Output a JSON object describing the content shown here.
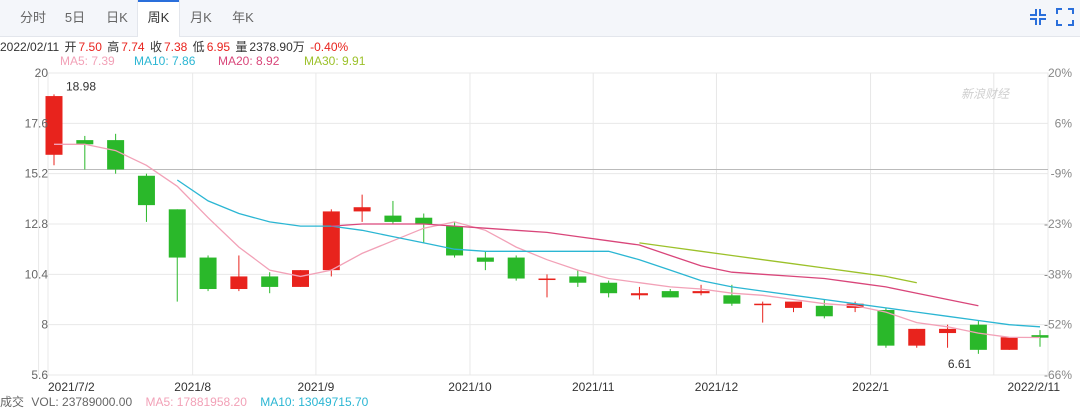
{
  "tabs": [
    {
      "label": "分时",
      "active": false
    },
    {
      "label": "5日",
      "active": false
    },
    {
      "label": "日K",
      "active": false
    },
    {
      "label": "周K",
      "active": true
    },
    {
      "label": "月K",
      "active": false
    },
    {
      "label": "年K",
      "active": false
    }
  ],
  "toolbar": {
    "shrink_icon": "collapse-icon",
    "expand_icon": "expand-icon"
  },
  "info": {
    "date": "2022/02/11",
    "open_label": "开",
    "open": "7.50",
    "high_label": "高",
    "high": "7.74",
    "close_label": "收",
    "close": "7.38",
    "low_label": "低",
    "low": "6.95",
    "vol_label": "量",
    "vol": "2378.90万",
    "change": "-0.40%"
  },
  "ma": [
    {
      "label": "MA5: 7.39",
      "color": "#f2a1b7"
    },
    {
      "label": "MA10: 7.86",
      "color": "#2bb6d3"
    },
    {
      "label": "MA20: 8.92",
      "color": "#d9467a"
    },
    {
      "label": "MA30: 9.91",
      "color": "#9cc12a"
    }
  ],
  "volume_legend": {
    "title": "成交",
    "vol": "VOL: 23789000.00",
    "ma5": "MA5: 17881958.20",
    "ma10": "MA10: 13049715.70",
    "ma5_color": "#f2a1b7",
    "ma10_color": "#2bb6d3"
  },
  "colors": {
    "up": "#e8231d",
    "down": "#2ab82a",
    "grid": "#e8e8e8"
  },
  "watermark": "新浪财经",
  "chart_data": {
    "type": "candlestick",
    "y_ticks": [
      "20",
      "17.6",
      "15.2",
      "12.8",
      "10.4",
      "8",
      "5.6"
    ],
    "ylim": [
      5.6,
      20
    ],
    "right_ticks": [
      "20%",
      "6%",
      "-9%",
      "-23%",
      "-38%",
      "-52%",
      "-66%"
    ],
    "x_labels": [
      {
        "label": "2021/7/2",
        "index": 0
      },
      {
        "label": "2021/8",
        "index": 5
      },
      {
        "label": "2021/9",
        "index": 9
      },
      {
        "label": "2021/10",
        "index": 14
      },
      {
        "label": "2021/11",
        "index": 18
      },
      {
        "label": "2021/12",
        "index": 22
      },
      {
        "label": "2022/1",
        "index": 27
      },
      {
        "label": "2022/2/11",
        "index": 31
      }
    ],
    "reference_price": 15.4,
    "annotations": [
      {
        "label": "18.98",
        "index": 0,
        "value": 18.98
      },
      {
        "label": "6.61",
        "index": 29,
        "value": 6.61
      }
    ],
    "candles": [
      {
        "o": 16.1,
        "h": 18.98,
        "l": 15.6,
        "c": 18.9
      },
      {
        "o": 16.8,
        "h": 17.0,
        "l": 15.4,
        "c": 16.6
      },
      {
        "o": 16.8,
        "h": 17.1,
        "l": 15.2,
        "c": 15.4
      },
      {
        "o": 15.1,
        "h": 15.2,
        "l": 12.9,
        "c": 13.7
      },
      {
        "o": 13.5,
        "h": 13.5,
        "l": 9.1,
        "c": 11.2
      },
      {
        "o": 11.2,
        "h": 11.3,
        "l": 9.6,
        "c": 9.7
      },
      {
        "o": 9.7,
        "h": 11.3,
        "l": 9.6,
        "c": 10.3
      },
      {
        "o": 10.3,
        "h": 10.5,
        "l": 9.5,
        "c": 9.8
      },
      {
        "o": 9.8,
        "h": 10.6,
        "l": 9.8,
        "c": 10.6
      },
      {
        "o": 10.6,
        "h": 13.5,
        "l": 10.3,
        "c": 13.4
      },
      {
        "o": 13.4,
        "h": 14.2,
        "l": 12.9,
        "c": 13.6
      },
      {
        "o": 13.2,
        "h": 13.9,
        "l": 12.8,
        "c": 12.9
      },
      {
        "o": 13.1,
        "h": 13.3,
        "l": 11.9,
        "c": 12.8
      },
      {
        "o": 12.7,
        "h": 12.9,
        "l": 11.2,
        "c": 11.3
      },
      {
        "o": 11.2,
        "h": 11.5,
        "l": 10.6,
        "c": 11.0
      },
      {
        "o": 11.2,
        "h": 11.3,
        "l": 10.1,
        "c": 10.2
      },
      {
        "o": 10.2,
        "h": 10.4,
        "l": 9.3,
        "c": 10.2
      },
      {
        "o": 10.3,
        "h": 10.6,
        "l": 9.8,
        "c": 10.0
      },
      {
        "o": 10.0,
        "h": 10.1,
        "l": 9.3,
        "c": 9.5
      },
      {
        "o": 9.4,
        "h": 9.8,
        "l": 9.2,
        "c": 9.5
      },
      {
        "o": 9.6,
        "h": 9.7,
        "l": 9.3,
        "c": 9.3
      },
      {
        "o": 9.5,
        "h": 9.9,
        "l": 9.4,
        "c": 9.6
      },
      {
        "o": 9.4,
        "h": 9.9,
        "l": 8.9,
        "c": 9.0
      },
      {
        "o": 9.0,
        "h": 9.1,
        "l": 8.1,
        "c": 9.0
      },
      {
        "o": 8.8,
        "h": 9.0,
        "l": 8.6,
        "c": 9.1
      },
      {
        "o": 8.9,
        "h": 9.2,
        "l": 8.3,
        "c": 8.4
      },
      {
        "o": 8.8,
        "h": 9.1,
        "l": 8.6,
        "c": 9.0
      },
      {
        "o": 8.7,
        "h": 8.8,
        "l": 6.9,
        "c": 7.0
      },
      {
        "o": 7.0,
        "h": 7.8,
        "l": 6.9,
        "c": 7.8
      },
      {
        "o": 7.6,
        "h": 8.0,
        "l": 6.9,
        "c": 7.8
      },
      {
        "o": 8.0,
        "h": 8.2,
        "l": 6.61,
        "c": 6.8
      },
      {
        "o": 6.8,
        "h": 7.4,
        "l": 6.8,
        "c": 7.4
      },
      {
        "o": 7.5,
        "h": 7.74,
        "l": 6.95,
        "c": 7.38
      }
    ],
    "series": [
      {
        "name": "MA5",
        "color": "#f2a1b7",
        "start": 0,
        "values": [
          16.6,
          16.6,
          16.3,
          15.6,
          14.6,
          13.1,
          11.7,
          10.6,
          10.3,
          10.6,
          11.4,
          12.0,
          12.6,
          12.9,
          12.5,
          11.7,
          11.1,
          10.6,
          10.2,
          10.0,
          9.8,
          9.7,
          9.5,
          9.4,
          9.2,
          9.0,
          8.9,
          8.6,
          8.1,
          7.9,
          7.6,
          7.4,
          7.39
        ]
      },
      {
        "name": "MA10",
        "color": "#2bb6d3",
        "start": 4,
        "values": [
          14.9,
          13.9,
          13.3,
          12.9,
          12.7,
          12.7,
          12.5,
          12.2,
          11.9,
          11.6,
          11.5,
          11.5,
          11.5,
          11.5,
          11.5,
          11.1,
          10.6,
          10.1,
          9.8,
          9.6,
          9.4,
          9.2,
          9.0,
          8.8,
          8.6,
          8.4,
          8.2,
          8.0,
          7.9
        ]
      },
      {
        "name": "MA20",
        "color": "#d9467a",
        "start": 9,
        "values": [
          12.7,
          12.8,
          12.8,
          12.8,
          12.7,
          12.6,
          12.5,
          12.4,
          12.2,
          12.0,
          11.8,
          11.3,
          10.8,
          10.5,
          10.4,
          10.3,
          10.2,
          10.0,
          9.8,
          9.5,
          9.2,
          8.9
        ]
      },
      {
        "name": "MA30",
        "color": "#9cc12a",
        "start": 19,
        "values": [
          11.9,
          11.7,
          11.5,
          11.3,
          11.1,
          10.9,
          10.7,
          10.5,
          10.3,
          10.0
        ]
      }
    ]
  }
}
